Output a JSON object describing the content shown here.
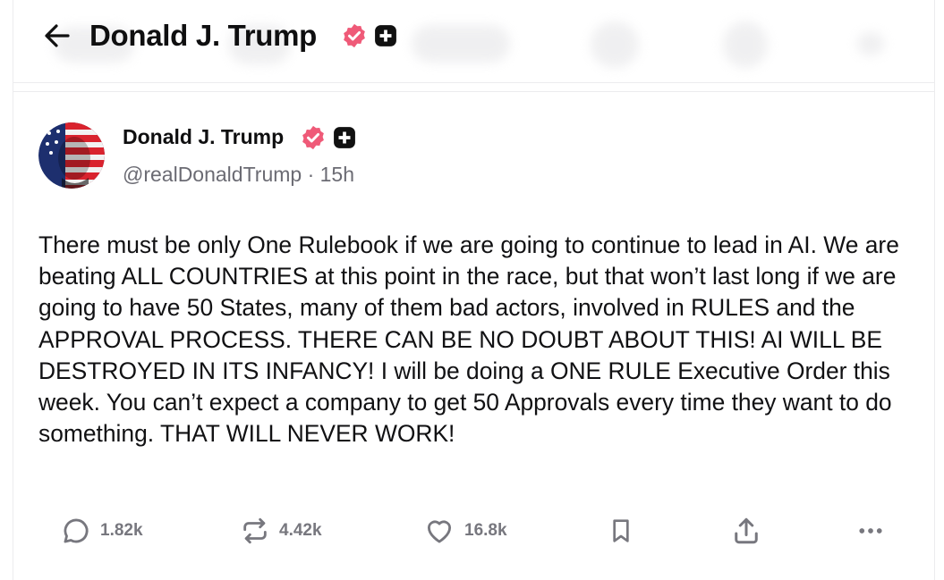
{
  "header": {
    "back_icon": "arrow-left-icon",
    "title": "Donald J. Trump",
    "verified_icon": "verified-badge-icon",
    "plus_icon": "truth-plus-icon"
  },
  "post": {
    "author": {
      "name": "Donald J. Trump",
      "handle": "@realDonaldTrump",
      "separator": "·",
      "time": "15h",
      "avatar_icon": "avatar-image"
    },
    "text": "There must be only One Rulebook if we are going to continue to lead in AI. We are beating ALL COUNTRIES at this point in the race, but that won’t last long if we are going to have 50 States, many of them bad actors, involved in RULES and the APPROVAL PROCESS. THERE CAN BE NO DOUBT ABOUT THIS! AI WILL BE DESTROYED IN ITS INFANCY! I will be doing a ONE RULE Executive Order this week. You can’t expect a company to get 50 Approvals every time they want to do something. THAT WILL NEVER WORK!",
    "actions": {
      "replies": "1.82k",
      "retruths": "4.42k",
      "likes": "16.8k"
    }
  },
  "colors": {
    "verified": "#ef5a78",
    "muted": "#77777e",
    "text": "#111113"
  }
}
